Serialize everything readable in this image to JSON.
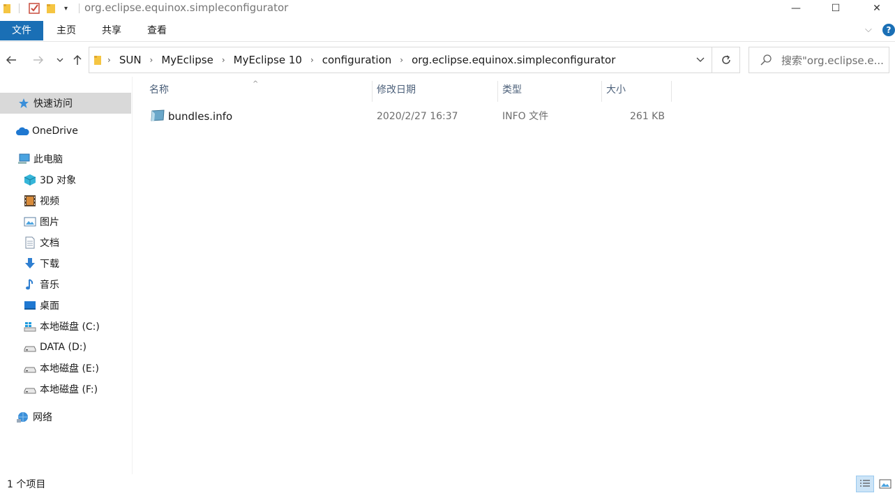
{
  "window": {
    "title": "org.eclipse.equinox.simpleconfigurator",
    "minimize_glyph": "—",
    "maximize_glyph": "☐",
    "close_glyph": "✕"
  },
  "ribbon": {
    "tabs": [
      "文件",
      "主页",
      "共享",
      "查看"
    ],
    "help_glyph": "?"
  },
  "address": {
    "crumbs": [
      "SUN",
      "MyEclipse",
      "MyEclipse 10",
      "configuration",
      "org.eclipse.equinox.simpleconfigurator"
    ],
    "separator": "›"
  },
  "search": {
    "placeholder": "搜索\"org.eclipse.e..."
  },
  "sidebar": {
    "items": [
      {
        "label": "快速访问",
        "icon": "star-icon"
      },
      {
        "label": "OneDrive",
        "icon": "cloud-icon"
      },
      {
        "label": "此电脑",
        "icon": "computer-icon"
      },
      {
        "label": "3D 对象",
        "icon": "cube-icon"
      },
      {
        "label": "视频",
        "icon": "video-icon"
      },
      {
        "label": "图片",
        "icon": "picture-icon"
      },
      {
        "label": "文档",
        "icon": "document-icon"
      },
      {
        "label": "下载",
        "icon": "download-icon"
      },
      {
        "label": "音乐",
        "icon": "music-icon"
      },
      {
        "label": "桌面",
        "icon": "desktop-icon"
      },
      {
        "label": "本地磁盘 (C:)",
        "icon": "windows-drive-icon"
      },
      {
        "label": "DATA (D:)",
        "icon": "drive-icon"
      },
      {
        "label": "本地磁盘 (E:)",
        "icon": "drive-icon"
      },
      {
        "label": "本地磁盘 (F:)",
        "icon": "drive-icon"
      },
      {
        "label": "网络",
        "icon": "network-icon"
      }
    ]
  },
  "columns": [
    "名称",
    "修改日期",
    "类型",
    "大小"
  ],
  "files": [
    {
      "name": "bundles.info",
      "modified": "2020/2/27 16:37",
      "type": "INFO 文件",
      "size": "261 KB"
    }
  ],
  "status": {
    "count": "1 个项目"
  },
  "colors": {
    "file_tab": "#1a6fb5",
    "selection": "#d9d9d9",
    "column_header": "#4c607a"
  }
}
